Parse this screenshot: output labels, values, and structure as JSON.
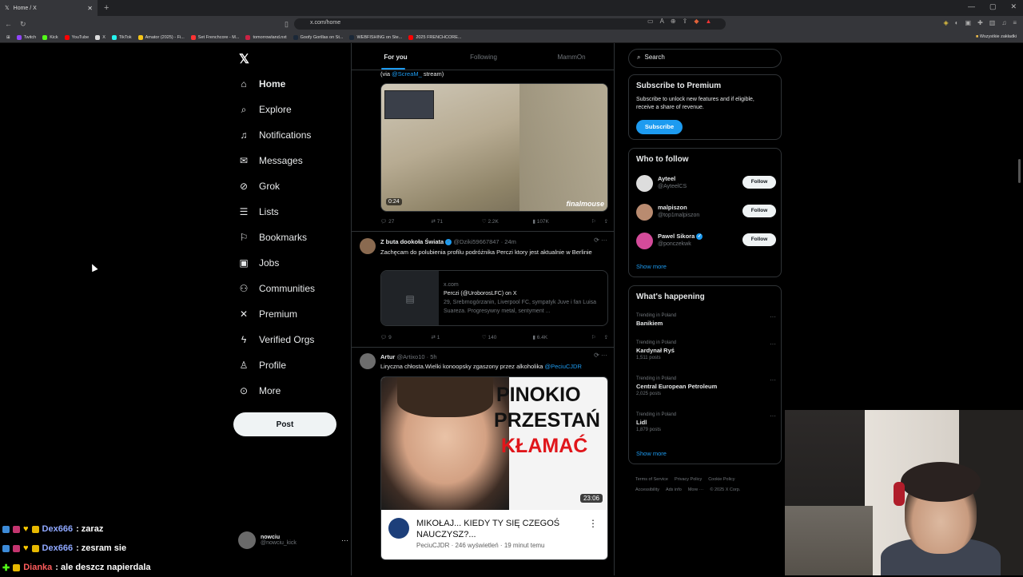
{
  "browser": {
    "tab_title": "Home / X",
    "url": "x.com/home",
    "bookmarks": [
      "Twitch",
      "Kick",
      "YouTube",
      "X",
      "TikTok",
      "Amator (2025) - Fi...",
      "Set Frenchcore - M...",
      "tomorrowland.nxt",
      "Goofy Gorillas on St...",
      "WEBFISHING on Ste...",
      "2025 FRENCHCORE..."
    ],
    "bookmarks_folder": "Wszystkie zakładki"
  },
  "nav": {
    "items": [
      {
        "label": "Home",
        "icon": "home-icon"
      },
      {
        "label": "Explore",
        "icon": "search-icon"
      },
      {
        "label": "Notifications",
        "icon": "bell-icon"
      },
      {
        "label": "Messages",
        "icon": "envelope-icon"
      },
      {
        "label": "Grok",
        "icon": "grok-icon"
      },
      {
        "label": "Lists",
        "icon": "list-icon"
      },
      {
        "label": "Bookmarks",
        "icon": "bookmark-icon"
      },
      {
        "label": "Jobs",
        "icon": "briefcase-icon"
      },
      {
        "label": "Communities",
        "icon": "people-icon"
      },
      {
        "label": "Premium",
        "icon": "x-icon"
      },
      {
        "label": "Verified Orgs",
        "icon": "lightning-icon"
      },
      {
        "label": "Profile",
        "icon": "person-icon"
      },
      {
        "label": "More",
        "icon": "more-circle-icon"
      }
    ],
    "post_label": "Post",
    "account": {
      "name": "nowciu",
      "handle": "@nowciu_kick"
    }
  },
  "feed": {
    "tabs": [
      "For you",
      "Following",
      "MammOn"
    ],
    "tweet1": {
      "text_prefix": "(via ",
      "mention": "@ScreaM_",
      "text_suffix": " stream)",
      "video_time": "0:24",
      "brand": "finalmouse",
      "replies": "27",
      "reposts": "71",
      "likes": "2.2K",
      "views": "107K"
    },
    "tweet2": {
      "name": "Z buta dookoła Świata",
      "handle": "@Dziki59667847 · 24m",
      "text": "Zachęcam do polubienia profilu podróżnika Perczi ktory jest aktualnie w Berlinie",
      "card_domain": "x.com",
      "card_title": "Perczi (@UroborosLFC) on X",
      "card_desc": "29, Srebrnogórzanin, Liverpool FC, sympatyk Juve i fan Luisa Suareza. Progresywny metal, sentyment ...",
      "replies": "9",
      "reposts": "1",
      "likes": "140",
      "views": "6.4K"
    },
    "tweet3": {
      "name": "Artur",
      "handle": "@Artixo10 · 5h",
      "text": "Liryczna chłosta.Wielki konoopsky zgaszony przez alkoholika ",
      "mention": "@PeciuCJDR",
      "thumb_line1": "PINOKIO",
      "thumb_line2": "PRZESTAŃ",
      "thumb_line3": "KŁAMAĆ",
      "duration": "23:06",
      "yt_title_1": "MIKOŁAJ... KIEDY TY SIĘ CZEGOŚ",
      "yt_title_2": "NAUCZYSZ?...",
      "yt_meta": "PeciuCJDR · 246 wyświetleń · 19 minut temu"
    }
  },
  "sidebar": {
    "search_placeholder": "Search",
    "premium": {
      "title": "Subscribe to Premium",
      "text": "Subscribe to unlock new features and if eligible, receive a share of revenue.",
      "button": "Subscribe"
    },
    "who_to_follow": {
      "title": "Who to follow",
      "accounts": [
        {
          "name": "Ayteel",
          "handle": "@AyteelCS"
        },
        {
          "name": "malpiszon",
          "handle": "@top1malpiszon"
        },
        {
          "name": "Pawel Sikora",
          "handle": "@ponczekwk"
        }
      ],
      "follow_label": "Follow",
      "show_more": "Show more"
    },
    "happening": {
      "title": "What's happening",
      "trends": [
        {
          "context": "Trending in Poland",
          "name": "Banikiem",
          "posts": ""
        },
        {
          "context": "Trending in Poland",
          "name": "Kardynał Ryś",
          "posts": "1,511 posts"
        },
        {
          "context": "Trending in Poland",
          "name": "Central European Petroleum",
          "posts": "2,025 posts"
        },
        {
          "context": "Trending in Poland",
          "name": "Lidl",
          "posts": "1,879 posts"
        }
      ],
      "show_more": "Show more"
    },
    "footer": {
      "line1": [
        "Terms of Service",
        "Privacy Policy",
        "Cookie Policy"
      ],
      "line2": [
        "Accessibility",
        "Ads info",
        "More ···",
        "© 2025 X Corp."
      ]
    }
  },
  "chat": [
    {
      "user": "Dex666",
      "message": " : zaraz"
    },
    {
      "user": "Dex666",
      "message": " : zesram sie"
    },
    {
      "user": "Dianka",
      "message": " : ale deszcz napierdala"
    }
  ]
}
